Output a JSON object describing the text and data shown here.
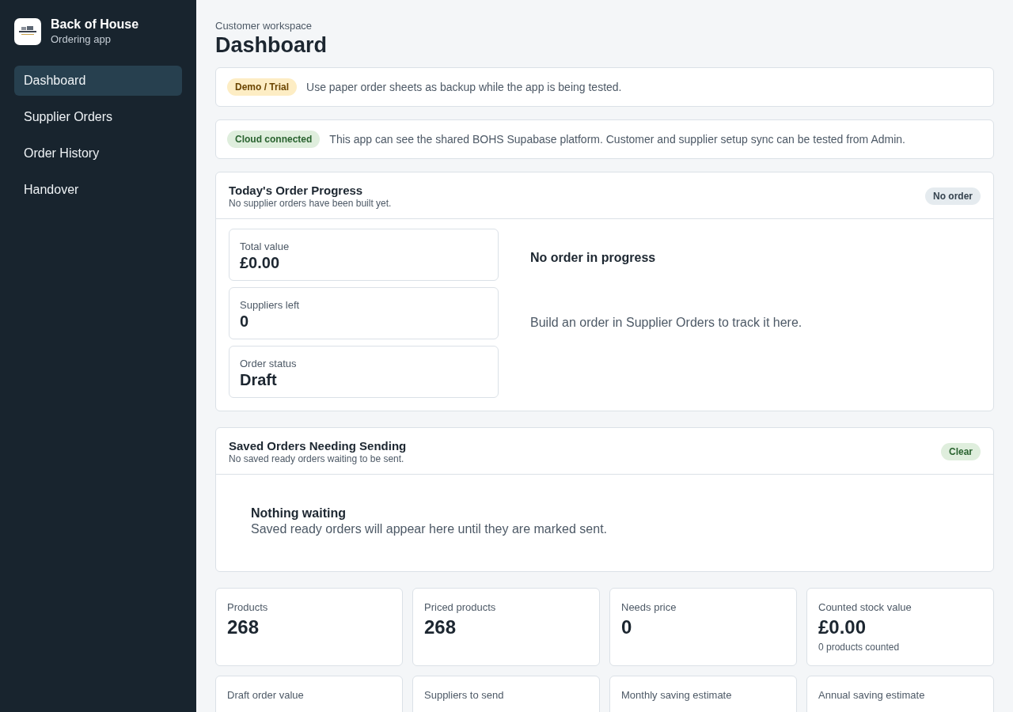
{
  "app": {
    "name": "Back of House",
    "subtitle": "Ordering app"
  },
  "nav": [
    {
      "label": "Dashboard",
      "selected": true
    },
    {
      "label": "Supplier Orders",
      "selected": false
    },
    {
      "label": "Order History",
      "selected": false
    },
    {
      "label": "Handover",
      "selected": false
    }
  ],
  "page": {
    "eyebrow": "Customer workspace",
    "title": "Dashboard"
  },
  "notices": [
    {
      "badge": "Demo / Trial",
      "color": "#fdedc4",
      "text": "Use paper order sheets as backup while the app is being tested."
    },
    {
      "badge": "Cloud connected",
      "color": "#dfeedd",
      "text": "This app can see the shared BOHS Supabase platform. Customer and supplier setup sync can be tested from Admin."
    }
  ],
  "progress": {
    "title": "Today's Order Progress",
    "subtitle": "No supplier orders have been built yet.",
    "badge": {
      "text": "No order",
      "color": "#e5ebef"
    },
    "stats": [
      {
        "label": "Total value",
        "value": "£0.00"
      },
      {
        "label": "Suppliers left",
        "value": "0"
      },
      {
        "label": "Order status",
        "value": "Draft"
      }
    ],
    "empty_title": "No order in progress",
    "empty_text": "Build an order in Supplier Orders to track it here."
  },
  "saved": {
    "title": "Saved Orders Needing Sending",
    "subtitle": "No saved ready orders waiting to be sent.",
    "badge": {
      "text": "Clear",
      "color": "#dfeedd"
    },
    "empty_title": "Nothing waiting",
    "empty_text": "Saved ready orders will appear here until they are marked sent."
  },
  "metrics": [
    {
      "label": "Products",
      "value": "268"
    },
    {
      "label": "Priced products",
      "value": "268"
    },
    {
      "label": "Needs price",
      "value": "0"
    },
    {
      "label": "Counted stock value",
      "value": "£0.00",
      "note": "0 products counted"
    },
    {
      "label": "Draft order value"
    },
    {
      "label": "Suppliers to send"
    },
    {
      "label": "Monthly saving estimate"
    },
    {
      "label": "Annual saving estimate"
    }
  ]
}
